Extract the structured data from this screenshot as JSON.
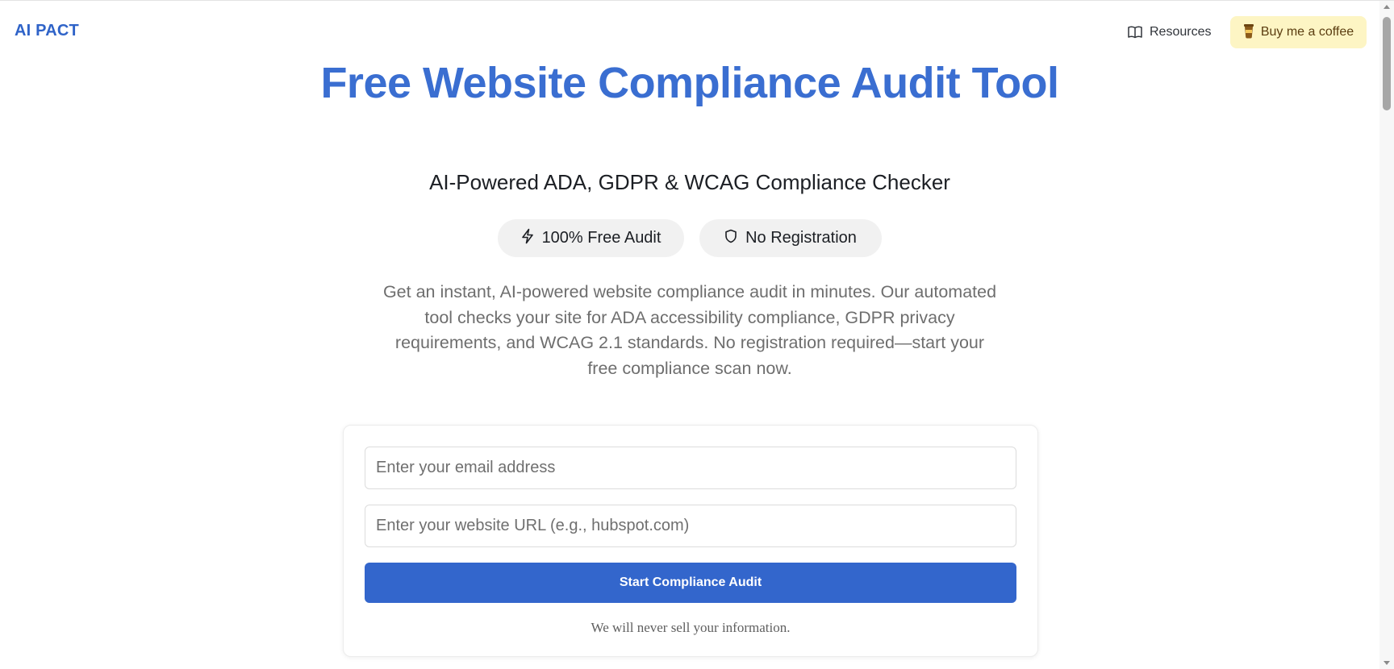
{
  "header": {
    "brand": "AI PACT",
    "resources_label": "Resources",
    "coffee_label": "Buy me a coffee",
    "resources_icon": "book-open-icon",
    "coffee_icon": "coffee-cup-icon"
  },
  "hero": {
    "title": "Free Website Compliance Audit Tool",
    "subtitle": "AI-Powered ADA, GDPR & WCAG Compliance Checker",
    "badges": [
      {
        "label": "100% Free Audit",
        "icon": "lightning-icon"
      },
      {
        "label": "No Registration",
        "icon": "shield-icon"
      }
    ],
    "description": "Get an instant, AI-powered website compliance audit in minutes. Our automated tool checks your site for ADA accessibility compliance, GDPR privacy requirements, and WCAG 2.1 standards. No registration required—start your free compliance scan now."
  },
  "form": {
    "email_placeholder": "Enter your email address",
    "email_value": "",
    "url_placeholder": "Enter your website URL (e.g., hubspot.com)",
    "url_value": "",
    "submit_label": "Start Compliance Audit",
    "privacy_note": "We will never sell your information."
  },
  "colors": {
    "brand": "#2f63c8",
    "title": "#3a6ed1",
    "button": "#3366cc",
    "coffee_bg": "#fdf5c4",
    "badge_bg": "#f1f1f1"
  }
}
